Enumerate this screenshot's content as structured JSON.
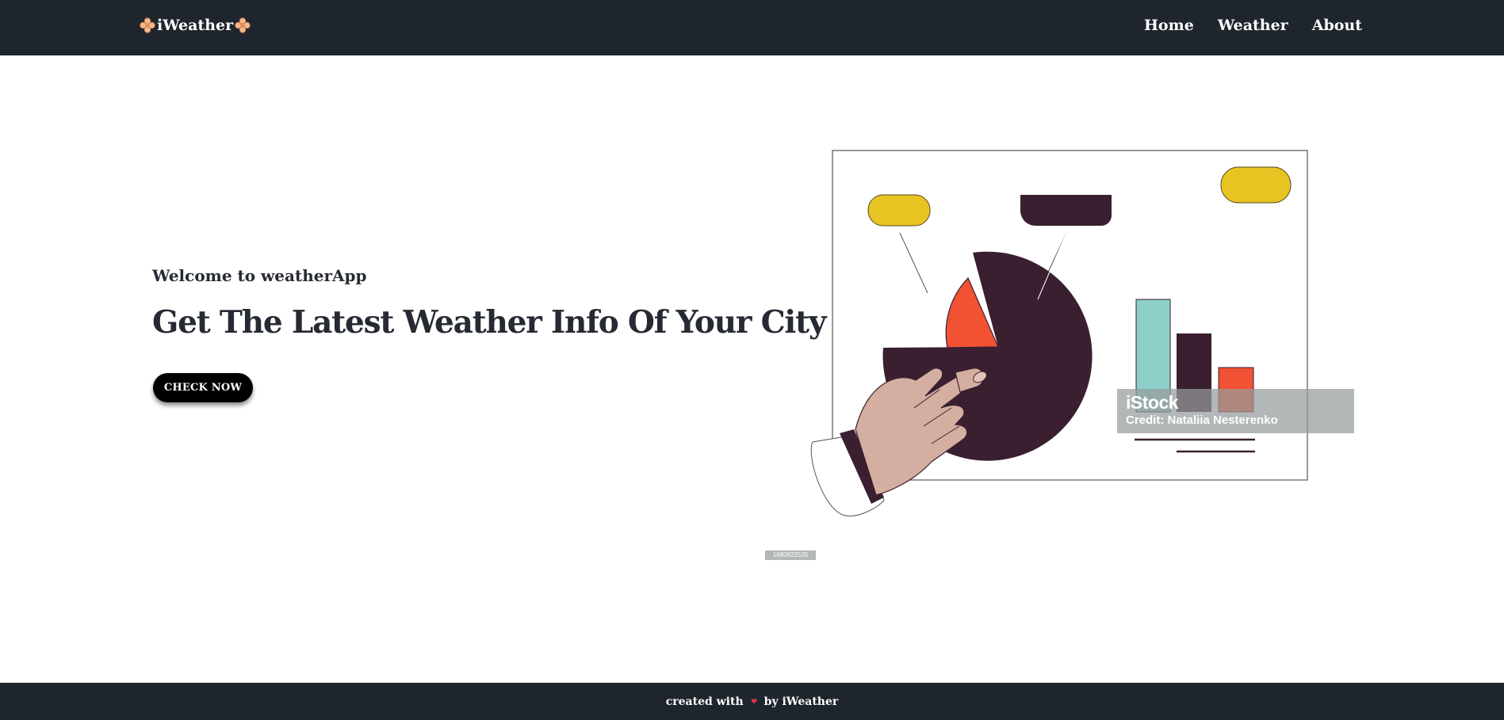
{
  "navbar": {
    "brand": "iWeather",
    "links": [
      {
        "label": "Home"
      },
      {
        "label": "Weather"
      },
      {
        "label": "About"
      }
    ]
  },
  "hero": {
    "welcome": "Welcome to weatherApp",
    "headline": "Get The Latest Weather Info Of Your City",
    "cta_label": "CHECK NOW"
  },
  "illustration": {
    "image_id": "1680922525",
    "watermark_logo": "iStock",
    "watermark_credit": "Credit: Nataliia Nesterenko"
  },
  "footer": {
    "prefix": "created with",
    "suffix": "by iWeather"
  },
  "icons": {
    "brand_left": "flower-icon",
    "brand_right": "flower-icon",
    "footer": "heart-icon"
  },
  "colors": {
    "nav_bg": "#1f252d",
    "footer_bg": "#1f252d",
    "text_dark": "#262a33",
    "button_bg": "#000000",
    "pie_dark": "#3a1f30",
    "pie_orange": "#f05233",
    "yellow": "#e8c423",
    "teal": "#8ecfca",
    "skin": "#d4aea0"
  }
}
